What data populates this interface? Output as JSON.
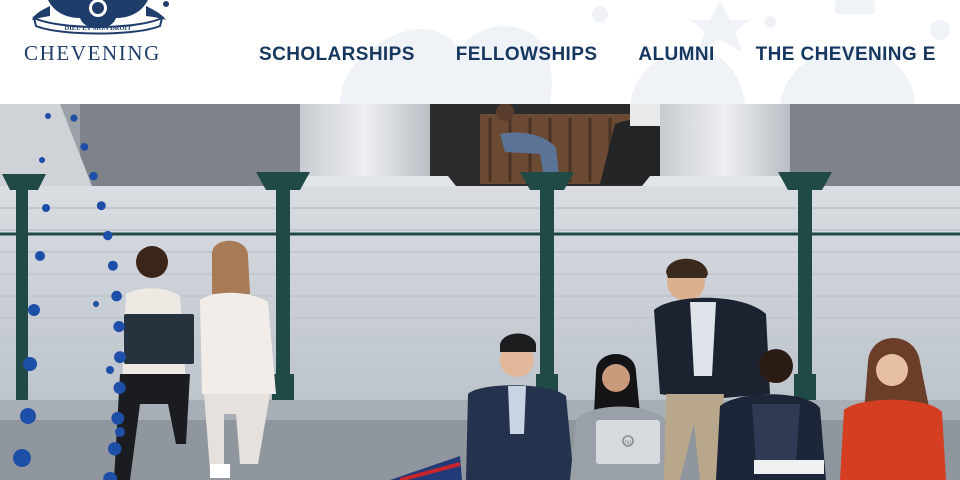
{
  "logo": {
    "motto_line1": "DIEU ET MON DROIT",
    "wordmark": "CHEVENING",
    "icon": "royal-crest-icon"
  },
  "nav": {
    "items": [
      {
        "label": "SCHOLARSHIPS"
      },
      {
        "label": "FELLOWSHIPS"
      },
      {
        "label": "ALUMNI"
      },
      {
        "label": "THE CHEVENING E"
      }
    ]
  },
  "hero": {
    "image": "students-on-steps-photo",
    "laptop_badge": "hp"
  },
  "colors": {
    "brand_navy": "#16375f",
    "dot_blue": "#1d4fa8",
    "header_bg": "#ffffff"
  }
}
